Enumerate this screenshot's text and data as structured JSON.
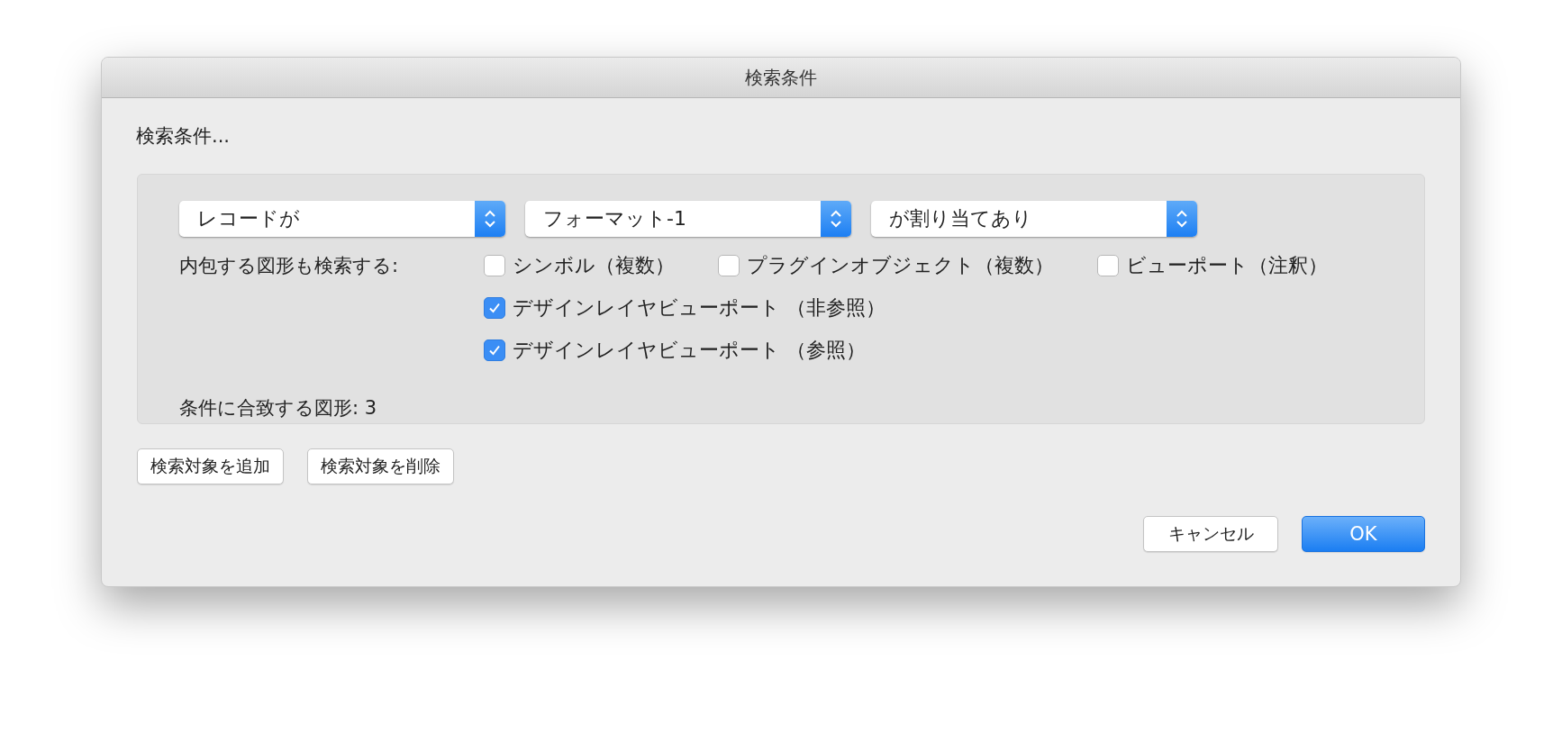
{
  "window": {
    "title": "検索条件"
  },
  "heading": "検索条件...",
  "criteria": [
    {
      "value": "レコードが"
    },
    {
      "value": "フォーマット-1"
    },
    {
      "value": "が割り当てあり"
    }
  ],
  "include_label": "内包する図形も検索する:",
  "option_rows": [
    [
      {
        "label": "シンボル（複数）",
        "checked": false
      },
      {
        "label": "プラグインオブジェクト（複数）",
        "checked": false
      },
      {
        "label": "ビューポート（注釈）",
        "checked": false
      }
    ],
    [
      {
        "label": "デザインレイヤビューポート （非参照）",
        "checked": true
      }
    ],
    [
      {
        "label": "デザインレイヤビューポート （参照）",
        "checked": true
      }
    ]
  ],
  "match_count": "条件に合致する図形:  3",
  "edit_buttons": [
    "検索対象を追加",
    "検索対象を削除"
  ],
  "cancel_button": "キャンセル",
  "ok_button": "OK"
}
